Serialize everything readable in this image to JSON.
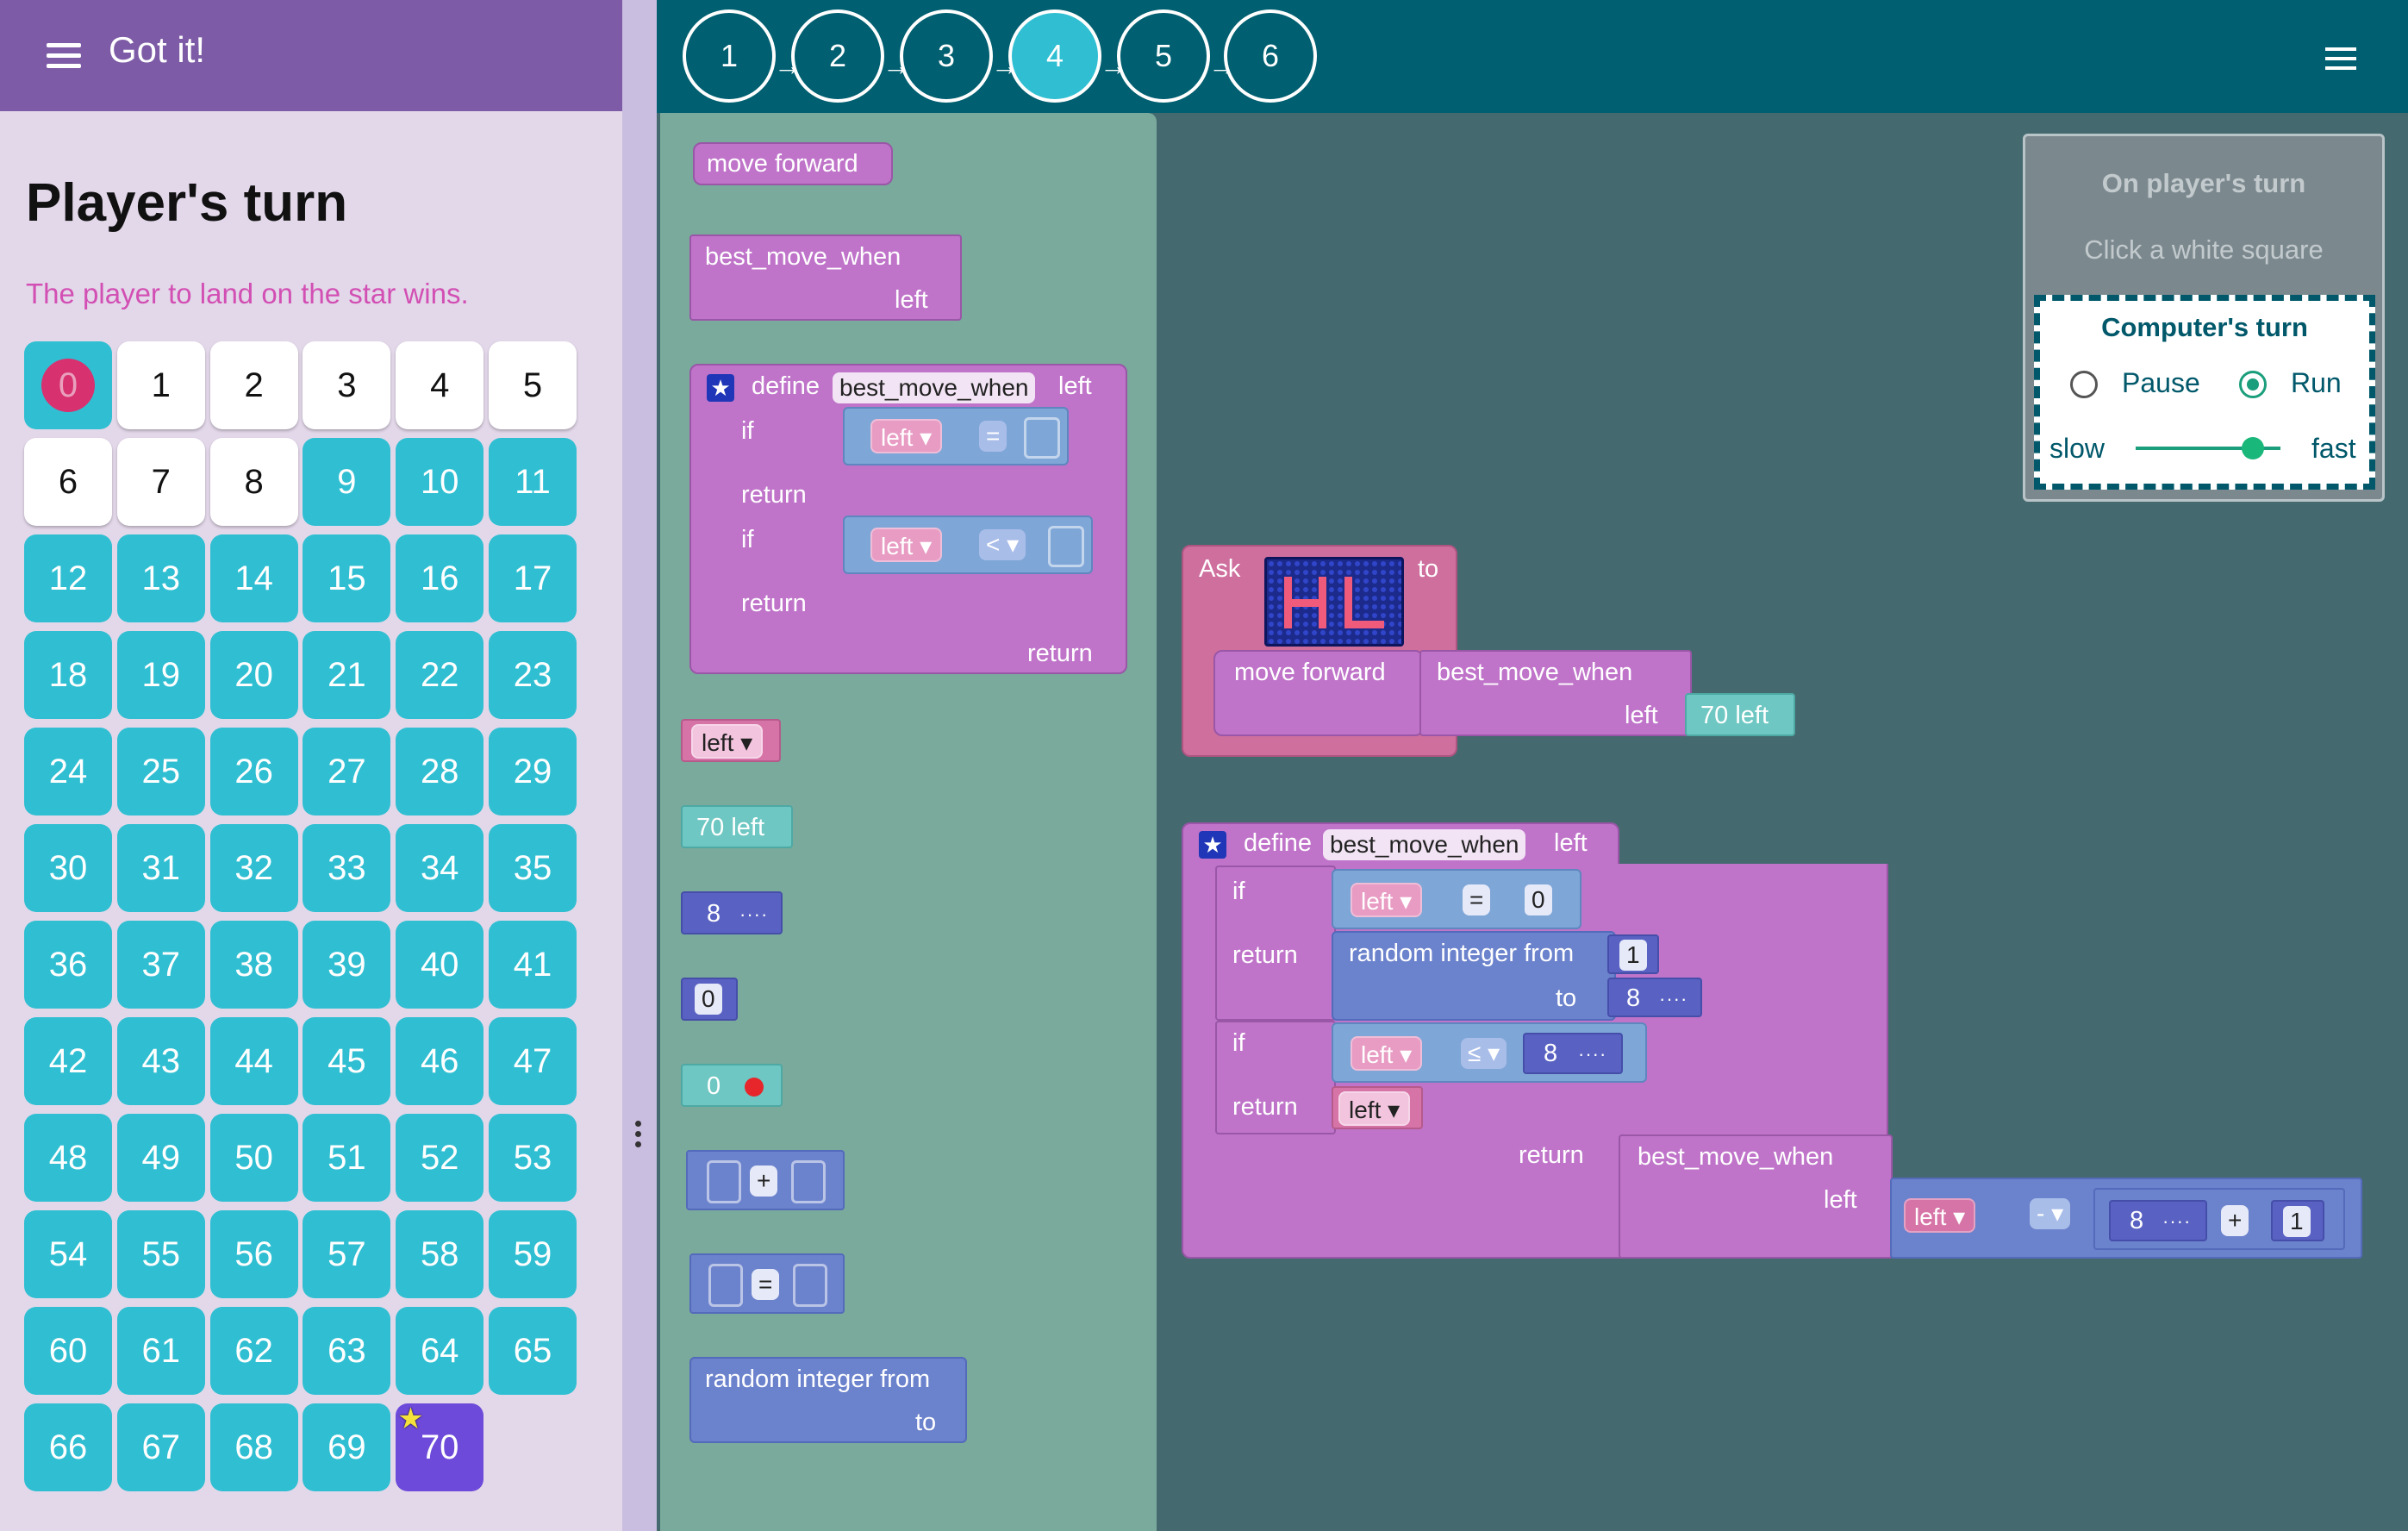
{
  "app": {
    "title": "Got it!"
  },
  "turn": {
    "heading": "Player's turn",
    "subtitle": "The player to land on the star wins."
  },
  "board": {
    "cells": [
      "0",
      "1",
      "2",
      "3",
      "4",
      "5",
      "6",
      "7",
      "8",
      "9",
      "10",
      "11",
      "12",
      "13",
      "14",
      "15",
      "16",
      "17",
      "18",
      "19",
      "20",
      "21",
      "22",
      "23",
      "24",
      "25",
      "26",
      "27",
      "28",
      "29",
      "30",
      "31",
      "32",
      "33",
      "34",
      "35",
      "36",
      "37",
      "38",
      "39",
      "40",
      "41",
      "42",
      "43",
      "44",
      "45",
      "46",
      "47",
      "48",
      "49",
      "50",
      "51",
      "52",
      "53",
      "54",
      "55",
      "56",
      "57",
      "58",
      "59",
      "60",
      "61",
      "62",
      "63",
      "64",
      "65",
      "66",
      "67",
      "68",
      "69",
      "70"
    ],
    "white_cells": [
      1,
      2,
      3,
      4,
      5,
      6,
      7,
      8
    ],
    "pawn_cell": 0,
    "goal_cell": 70
  },
  "steps": {
    "labels": [
      "1",
      "2",
      "3",
      "4",
      "5",
      "6"
    ],
    "active": "4",
    "arrow": "→"
  },
  "panel": {
    "player_title": "On player's turn",
    "player_hint": "Click a white square",
    "computer_title": "Computer's turn",
    "pause": "Pause",
    "run": "Run",
    "selected": "Run",
    "slow": "slow",
    "fast": "fast"
  },
  "toolbox": {
    "move_forward": "move forward",
    "best_move_when": "best_move_when",
    "left": "left",
    "define": "define",
    "if": "if",
    "return": "return",
    "eq": "=",
    "lt": "<",
    "left_var": "left",
    "seventy_left": "70 left",
    "eight": "8",
    "zero": "0",
    "zero_red": "0",
    "plus": "+",
    "random_from": "random integer from",
    "to": "to"
  },
  "workspace": {
    "ask": "Ask",
    "to": "to",
    "move_forward": "move forward",
    "best_move_when": "best_move_when",
    "left": "left",
    "seventy_left": "70 left",
    "define": "define",
    "fn_name": "best_move_when",
    "param": "left",
    "if": "if",
    "return": "return",
    "eq": "=",
    "le": "≤",
    "minus": "-",
    "plus": "+",
    "zero": "0",
    "one": "1",
    "eight": "8",
    "random_from": "random integer from",
    "to_label": "to",
    "left_var": "left",
    "dots": "····"
  },
  "icons": {
    "hamburger": "menu-icon",
    "star": "star-icon",
    "dropdown": "▾",
    "define_star": "★"
  },
  "colors": {
    "header_purple": "#7d5ba6",
    "header_teal": "#005f70",
    "cell_teal": "#30bfd2",
    "goal_purple": "#6d4ad9",
    "pawn": "#d8316f",
    "workspace": "#44696f",
    "toolbox": "#79aa9b"
  }
}
